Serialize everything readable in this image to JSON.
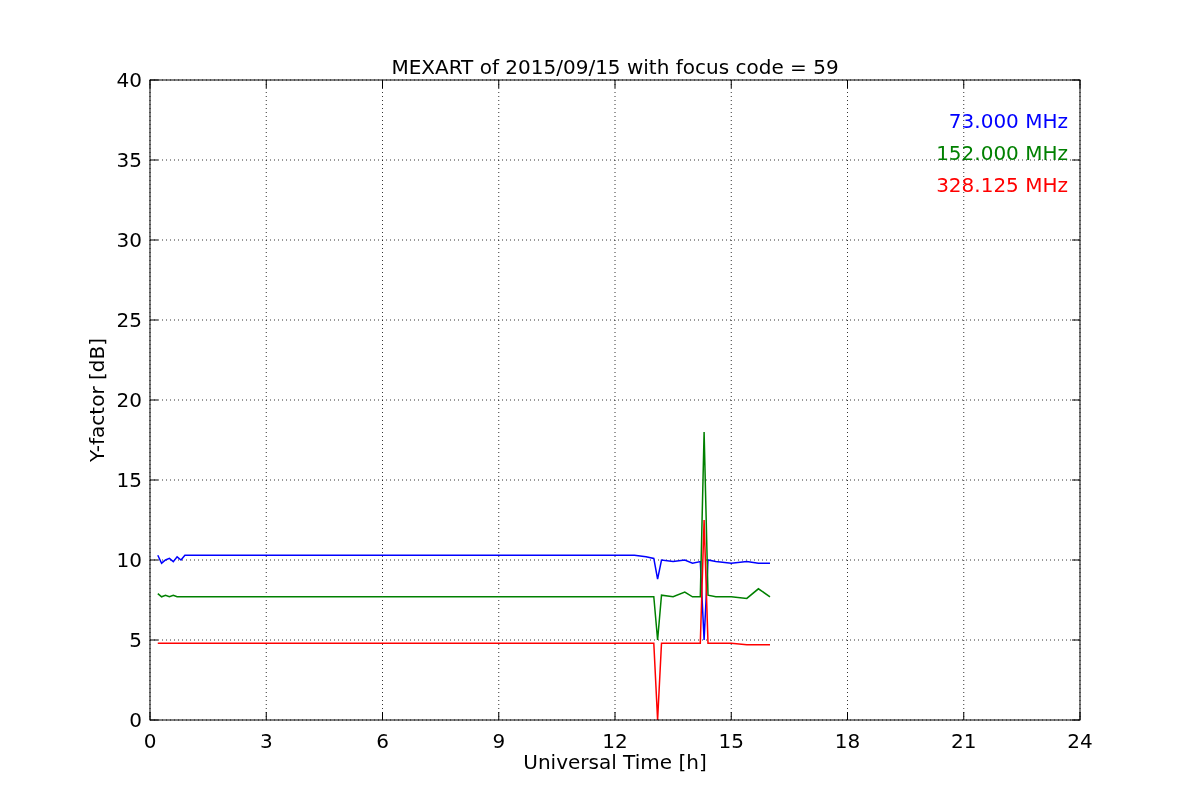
{
  "chart_data": {
    "type": "line",
    "title": "MEXART of 2015/09/15 with focus code = 59",
    "xlabel": "Universal Time [h]",
    "ylabel": "Y-factor [dB]",
    "x": [
      0.2,
      0.3,
      0.4,
      0.5,
      0.6,
      0.7,
      0.8,
      0.9,
      12.5,
      12.8,
      13.0,
      13.1,
      13.2,
      13.5,
      13.8,
      14.0,
      14.2,
      14.3,
      14.4,
      14.6,
      15.0,
      15.4,
      15.7,
      16.0
    ],
    "series": [
      {
        "name": "73.000 MHz",
        "color": "#0000ff",
        "values": [
          10.3,
          9.8,
          10.0,
          10.1,
          9.9,
          10.2,
          10.0,
          10.3,
          10.3,
          10.2,
          10.1,
          8.8,
          10.0,
          9.9,
          10.0,
          9.8,
          9.9,
          5.0,
          10.0,
          9.9,
          9.8,
          9.9,
          9.8,
          9.8
        ]
      },
      {
        "name": "152.000 MHz",
        "color": "#008000",
        "values": [
          7.9,
          7.7,
          7.8,
          7.7,
          7.8,
          7.7,
          7.7,
          7.7,
          7.7,
          7.7,
          7.7,
          5.0,
          7.8,
          7.7,
          8.0,
          7.7,
          7.7,
          18.0,
          7.8,
          7.7,
          7.7,
          7.6,
          8.2,
          7.7
        ]
      },
      {
        "name": "328.125 MHz",
        "color": "#ff0000",
        "values": [
          4.8,
          4.8,
          4.8,
          4.8,
          4.8,
          4.8,
          4.8,
          4.8,
          4.8,
          4.8,
          4.8,
          0.0,
          4.8,
          4.8,
          4.8,
          4.8,
          4.8,
          12.5,
          4.8,
          4.8,
          4.8,
          4.7,
          4.7,
          4.7
        ]
      }
    ],
    "grid": true,
    "xlim": [
      0,
      24
    ],
    "ylim": [
      0,
      40
    ],
    "xticks": [
      0,
      3,
      6,
      9,
      12,
      15,
      18,
      21,
      24
    ],
    "yticks": [
      0,
      5,
      10,
      15,
      20,
      25,
      30,
      35,
      40
    ]
  }
}
